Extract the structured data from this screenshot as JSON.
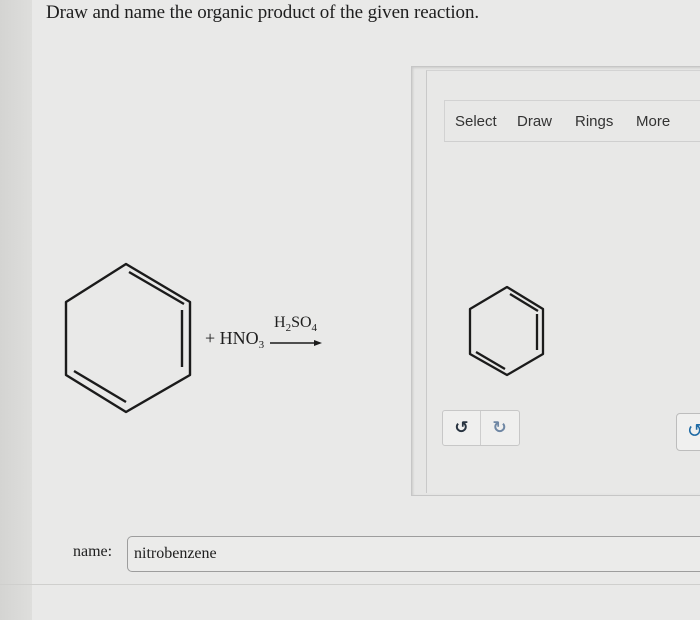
{
  "question": {
    "text": "Draw and name the organic product of the given reaction."
  },
  "reaction": {
    "reagent_prefix": "+ HNO",
    "reagent_subscript": "3",
    "catalyst_a": "H",
    "catalyst_a_sub": "2",
    "catalyst_b": "SO",
    "catalyst_b_sub": "4"
  },
  "editor": {
    "tabs": [
      "Select",
      "Draw",
      "Rings",
      "More"
    ],
    "undo_icon": "undo-icon",
    "redo_icon": "redo-icon"
  },
  "answer": {
    "label": "name:",
    "value": "nitrobenzene"
  },
  "colors": {
    "page_bg": "#e9e9e8",
    "redo_accent": "#6f87a4",
    "edge_icon": "#1e6aa5"
  }
}
